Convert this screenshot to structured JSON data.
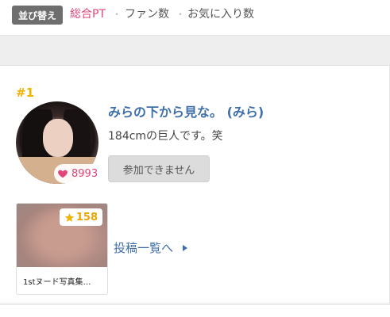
{
  "sort": {
    "badge_label": "並び替え",
    "options": [
      "総合PT",
      "ファン数",
      "お気に入り数"
    ],
    "separator": "・",
    "active_color": "#e0457b"
  },
  "creator": {
    "rank": "#1",
    "name": "みらの下から見な。 (みら)",
    "bio": "184cmの巨人です。笑",
    "fan_count": "8993",
    "join_label": "参加できません"
  },
  "post": {
    "stars": "158",
    "title": "1stヌード写真集…",
    "list_link": "投稿一覧へ"
  },
  "icons": {
    "heart": "heart-icon",
    "star": "star-icon",
    "arrow": "caret-right-icon"
  }
}
